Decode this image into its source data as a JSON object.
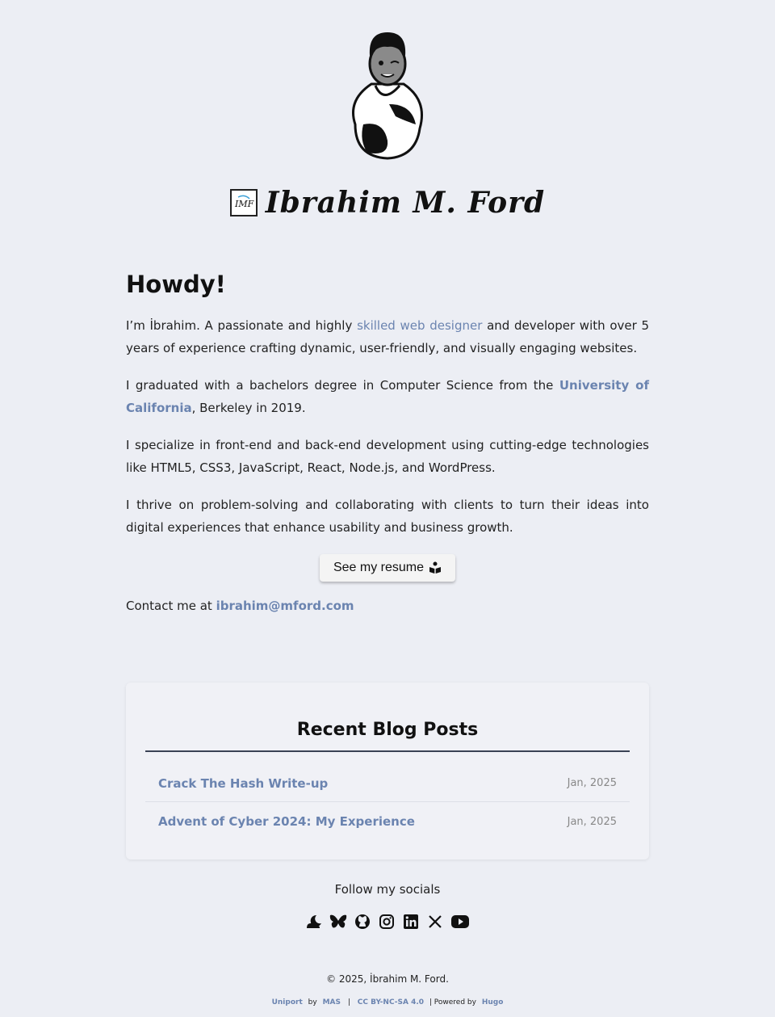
{
  "site": {
    "title": "Ibrahim M. Ford",
    "logo_icon": "monogram-logo-icon",
    "avatar_icon": "cartoon-avatar-icon"
  },
  "intro": {
    "heading": "Howdy!",
    "p1_pre": "I’m İbrahim. A passionate and highly ",
    "p1_link": "skilled web designer",
    "p1_post": " and developer with over 5 years of experience crafting dynamic, user-friendly, and visually engaging websites.",
    "p2_pre": "I graduated with a bachelors degree in Computer Science from the ",
    "p2_link": "University of California",
    "p2_post": ", Berkeley in 2019.",
    "p3": "I specialize in front-end and back-end development using cutting-edge technologies like HTML5, CSS3, JavaScript, React, Node.js, and WordPress.",
    "p4": "I thrive on problem-solving and collaborating with clients to turn their ideas into digital experiences that enhance usability and business growth.",
    "resume_button": "See my resume",
    "resume_icon": "book-reader-icon",
    "contact_pre": "Contact me at ",
    "contact_email": "ibrahim@mford.com"
  },
  "blog": {
    "heading": "Recent Blog Posts",
    "posts": [
      {
        "title": "Crack The Hash Write-up",
        "date": "Jan, 2025"
      },
      {
        "title": "Advent of Cyber 2024: My Experience",
        "date": "Jan, 2025"
      }
    ]
  },
  "footer": {
    "follow": "Follow my socials",
    "socials": [
      "mastodon-cloud-icon",
      "bluesky-butterfly-icon",
      "github-icon",
      "instagram-icon",
      "linkedin-icon",
      "x-icon",
      "youtube-icon"
    ],
    "copyright": "© 2025, İbrahim M. Ford.",
    "theme": "Uniport",
    "by": "by",
    "author": "MAS",
    "sep1": "|",
    "license": "CC BY-NC-SA 4.0",
    "powered": "| Powered by",
    "engine": "Hugo"
  },
  "colors": {
    "background": "#eceef4",
    "link": "#6b84b0",
    "text": "#222222"
  }
}
